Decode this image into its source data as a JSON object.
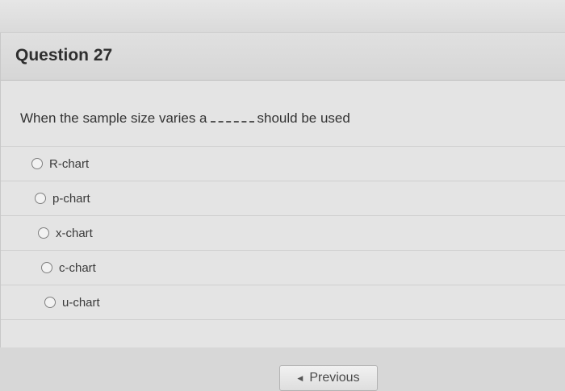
{
  "question": {
    "title": "Question 27",
    "text_before": "When the sample size varies a",
    "text_after": "should be used"
  },
  "options": [
    {
      "label": "R-chart",
      "selected": false
    },
    {
      "label": "p-chart",
      "selected": false
    },
    {
      "label": "x-chart",
      "selected": false
    },
    {
      "label": "c-chart",
      "selected": false
    },
    {
      "label": "u-chart",
      "selected": false
    }
  ],
  "navigation": {
    "previous_label": "Previous",
    "previous_icon": "triangle-left-icon"
  }
}
